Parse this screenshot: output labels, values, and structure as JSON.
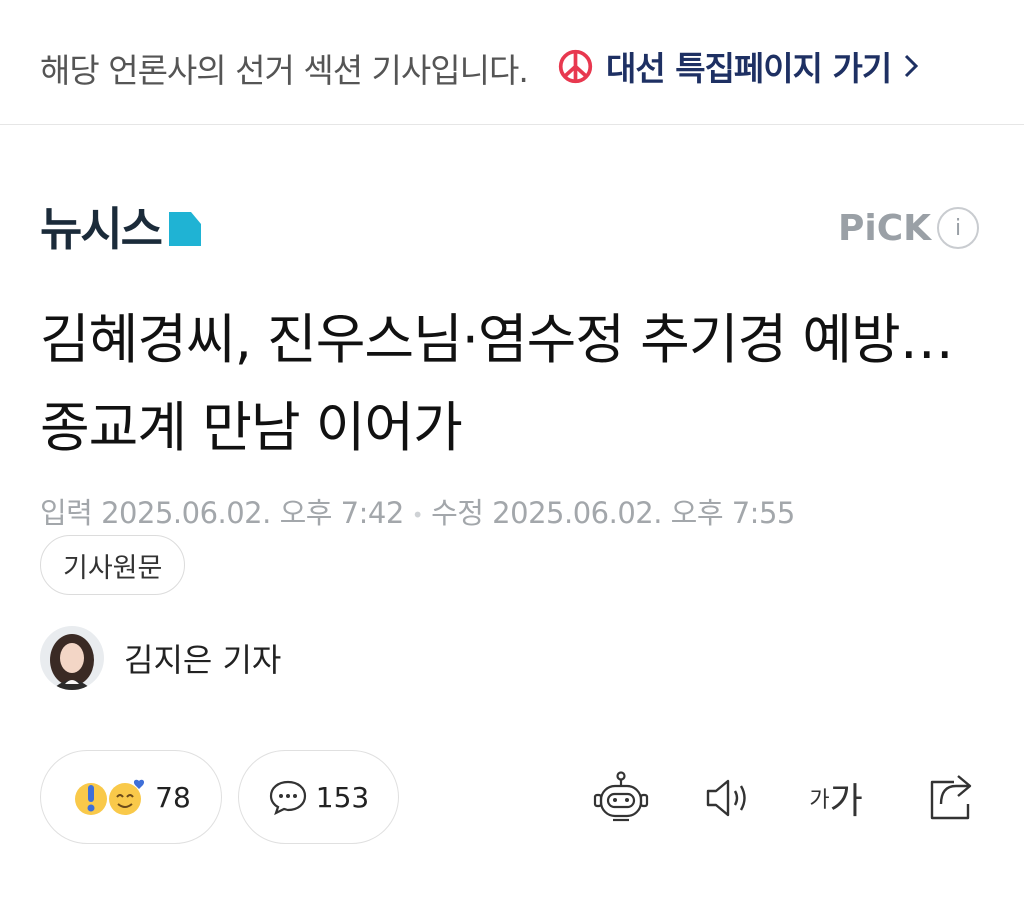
{
  "topbar": {
    "notice": "해당 언론사의 선거 섹션 기사입니다.",
    "election_link": "대선 특집페이지 가기",
    "colors": {
      "ballot": "#e8384f",
      "link": "#1e3063"
    }
  },
  "press": {
    "name": "뉴시스",
    "pick_label": "PiCK",
    "info_glyph": "i"
  },
  "article": {
    "headline": "김혜경씨, 진우스님·염수정 추기경 예방…종교계 만남 이어가",
    "published_label": "입력",
    "published": "2025.06.02. 오후 7:42",
    "modified_label": "수정",
    "modified": "2025.06.02. 오후 7:55",
    "origin_button": "기사원문",
    "author": "김지은 기자"
  },
  "actions": {
    "reaction_count": "78",
    "comment_count": "153",
    "font_small": "가",
    "font_big": "가",
    "icons": [
      "alert-emoji-icon",
      "smile-heart-emoji-icon",
      "comment-bubble-icon",
      "robot-summary-icon",
      "speaker-icon",
      "share-icon"
    ]
  }
}
